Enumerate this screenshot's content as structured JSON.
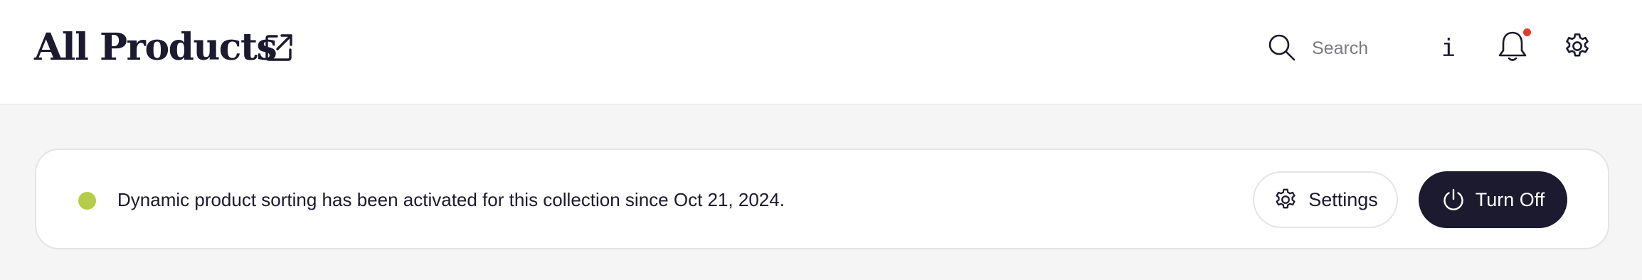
{
  "header": {
    "title": "All Products",
    "external_link_icon": "external-link-icon",
    "search": {
      "icon": "search-icon",
      "placeholder": "Search",
      "value": ""
    },
    "info_label": "i",
    "bell_icon": "bell-icon",
    "bell_has_notification": true,
    "gear_icon": "gear-icon"
  },
  "banner": {
    "status_color": "#b5cc4a",
    "message": "Dynamic product sorting has been activated for this collection since Oct 21, 2024.",
    "settings_button": {
      "icon": "gear-icon",
      "label": "Settings"
    },
    "turn_off_button": {
      "icon": "power-icon",
      "label": "Turn Off"
    }
  },
  "colors": {
    "ink": "#1b1a2e",
    "notification": "#e5392b",
    "page_bg": "#f5f5f6"
  }
}
